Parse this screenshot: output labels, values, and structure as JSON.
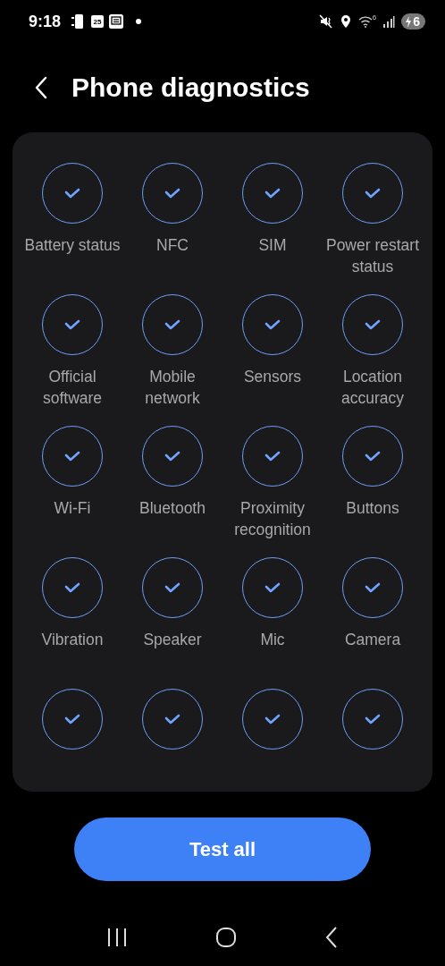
{
  "status_bar": {
    "time": "9:18",
    "calendar_day": "25",
    "wifi_label": "6",
    "battery": "6"
  },
  "header": {
    "title": "Phone diagnostics"
  },
  "tests": [
    {
      "label": "Battery status",
      "checked": true
    },
    {
      "label": "NFC",
      "checked": true
    },
    {
      "label": "SIM",
      "checked": true
    },
    {
      "label": "Power restart status",
      "checked": true
    },
    {
      "label": "Official software",
      "checked": true
    },
    {
      "label": "Mobile network",
      "checked": true
    },
    {
      "label": "Sensors",
      "checked": true
    },
    {
      "label": "Location accuracy",
      "checked": true
    },
    {
      "label": "Wi-Fi",
      "checked": true
    },
    {
      "label": "Bluetooth",
      "checked": true
    },
    {
      "label": "Proximity recognition",
      "checked": true
    },
    {
      "label": "Buttons",
      "checked": true
    },
    {
      "label": "Vibration",
      "checked": true
    },
    {
      "label": "Speaker",
      "checked": true
    },
    {
      "label": "Mic",
      "checked": true
    },
    {
      "label": "Camera",
      "checked": true
    },
    {
      "checked": true
    },
    {
      "checked": true
    },
    {
      "checked": true
    },
    {
      "checked": true
    }
  ],
  "primary_button": {
    "label": "Test all"
  }
}
